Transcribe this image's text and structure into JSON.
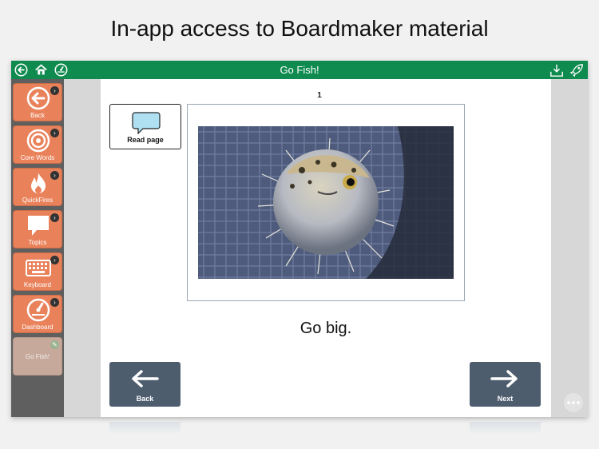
{
  "headline": "In-app access to Boardmaker material",
  "topbar": {
    "title": "Go Fish!",
    "back_icon": "circle-arrow-left-icon",
    "home_icon": "home-icon",
    "dashboard_icon": "gauge-icon",
    "download_icon": "download-icon",
    "rocket_icon": "rocket-icon"
  },
  "sidebar": {
    "items": [
      {
        "label": "Back",
        "icon": "circle-arrow-left-icon"
      },
      {
        "label": "Core Words",
        "icon": "target-icon"
      },
      {
        "label": "QuickFires",
        "icon": "flame-icon"
      },
      {
        "label": "Topics",
        "icon": "speech-bubble-icon"
      },
      {
        "label": "Keyboard",
        "icon": "keyboard-icon"
      },
      {
        "label": "Dashboard",
        "icon": "gauge-icon"
      },
      {
        "label": "Go Fish!",
        "icon": "",
        "disabled": true
      }
    ]
  },
  "page": {
    "number": "1",
    "read_label": "Read page",
    "caption": "Go big.",
    "photo_icon": "pufferfish-photo"
  },
  "nav": {
    "back_label": "Back",
    "next_label": "Next"
  },
  "colors": {
    "topbar": "#0f8b4f",
    "sidebar_button": "#e9825b",
    "nav_button": "#4d5d6e"
  }
}
